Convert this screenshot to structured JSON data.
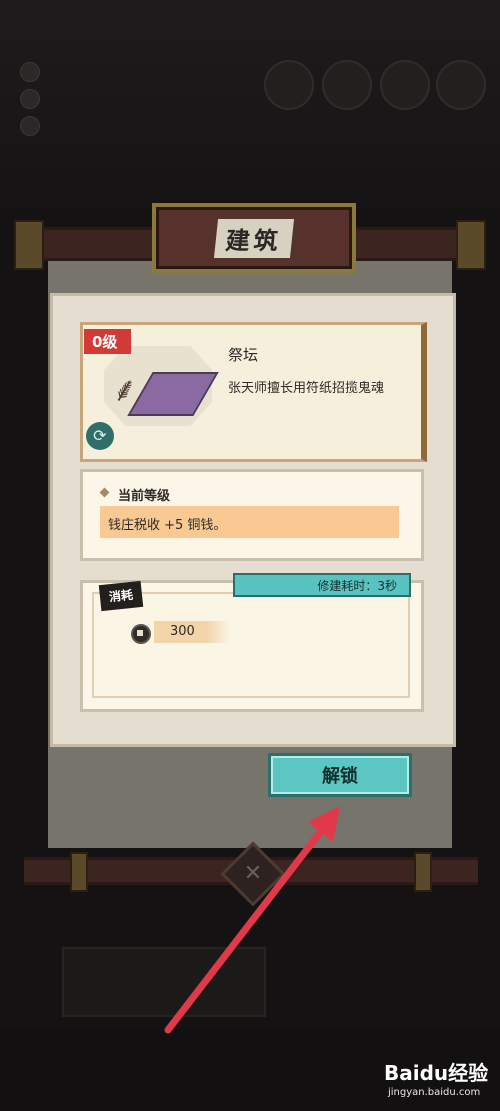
{
  "panel": {
    "title": "建筑",
    "building": {
      "level_badge": "0级",
      "name": "祭坛",
      "description": "张天师擅长用符纸招揽鬼魂"
    },
    "current_level": {
      "heading": "当前等级",
      "effect": "钱庄税收 +5 铜钱。"
    },
    "cost": {
      "tag": "消耗",
      "build_time": "修建耗时：3秒",
      "amount": "300"
    },
    "unlock_label": "解锁"
  },
  "watermark": {
    "brand": "Baidu经验",
    "url": "jingyan.baidu.com"
  },
  "colors": {
    "accent_teal": "#5cc6c2",
    "level_badge_red": "#d13a36",
    "effect_bar": "#f9c994",
    "arrow_red": "#e03a4a"
  }
}
